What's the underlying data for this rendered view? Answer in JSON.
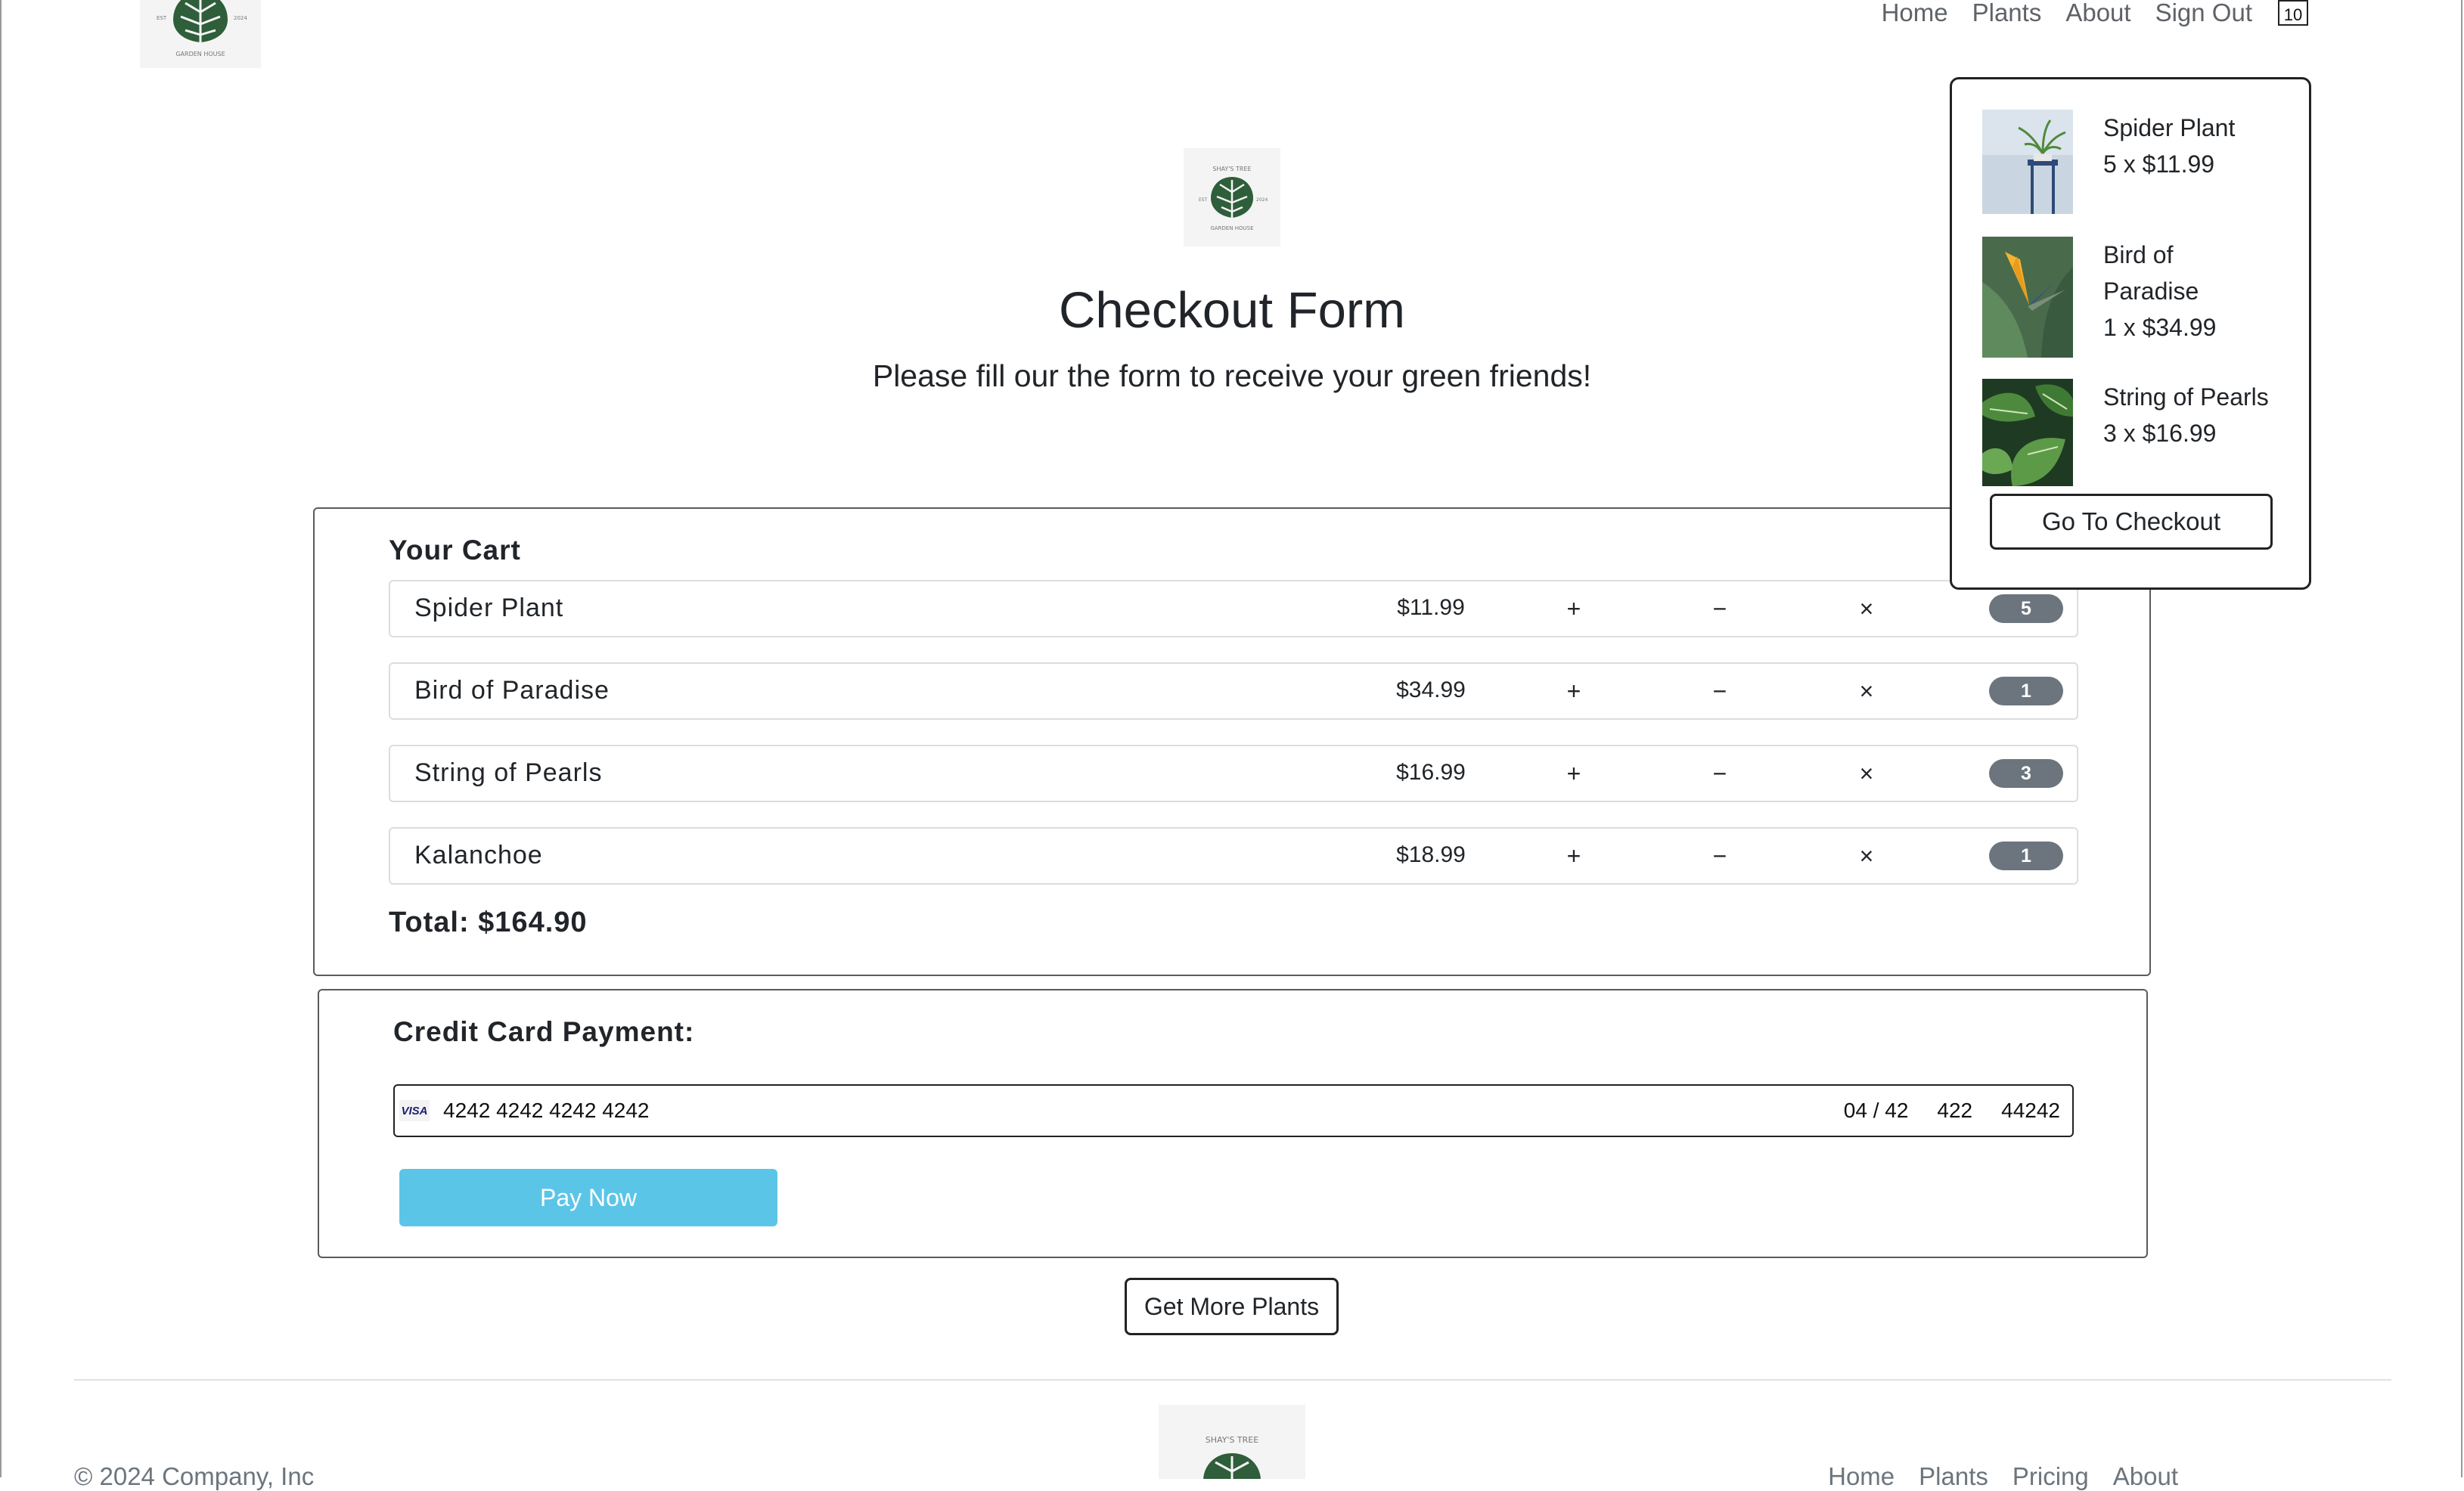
{
  "nav": {
    "links": [
      "Home",
      "Plants",
      "About",
      "Sign Out"
    ],
    "cart_count": "10"
  },
  "logo": {
    "brand_top": "SHAY'S TREE",
    "brand_bottom": "GARDEN HOUSE",
    "est": "EST",
    "year": "2024"
  },
  "mini_cart": {
    "items": [
      {
        "name": "Spider Plant",
        "qty_price": "5 x $11.99"
      },
      {
        "name": "Bird of Paradise",
        "qty_price": "1 x $34.99"
      },
      {
        "name": "String of Pearls",
        "qty_price": "3 x $16.99"
      }
    ],
    "checkout_label": "Go To Checkout"
  },
  "header": {
    "title": "Checkout Form",
    "subtitle": "Please fill our the form to receive your green friends!"
  },
  "cart": {
    "heading": "Your Cart",
    "items": [
      {
        "name": "Spider Plant",
        "price": "$11.99",
        "plus": "+",
        "minus": "−",
        "remove": "×",
        "qty": "5"
      },
      {
        "name": "Bird of Paradise",
        "price": "$34.99",
        "plus": "+",
        "minus": "−",
        "remove": "×",
        "qty": "1"
      },
      {
        "name": "String of Pearls",
        "price": "$16.99",
        "plus": "+",
        "minus": "−",
        "remove": "×",
        "qty": "3"
      },
      {
        "name": "Kalanchoe",
        "price": "$18.99",
        "plus": "+",
        "minus": "−",
        "remove": "×",
        "qty": "1"
      }
    ],
    "total": "Total: $164.90"
  },
  "payment": {
    "heading": "Credit Card Payment:",
    "card_brand": "VISA",
    "card_number": "4242 4242 4242 4242",
    "expiry": "04 / 42",
    "cvc": "422",
    "zip": "44242",
    "pay_label": "Pay Now"
  },
  "more_plants_label": "Get More Plants",
  "footer": {
    "copyright": "© 2024 Company, Inc",
    "links": [
      "Home",
      "Plants",
      "Pricing",
      "About"
    ]
  },
  "colors": {
    "pay_button": "#5bc5e8",
    "badge": "#6c757d",
    "text": "#212529"
  }
}
